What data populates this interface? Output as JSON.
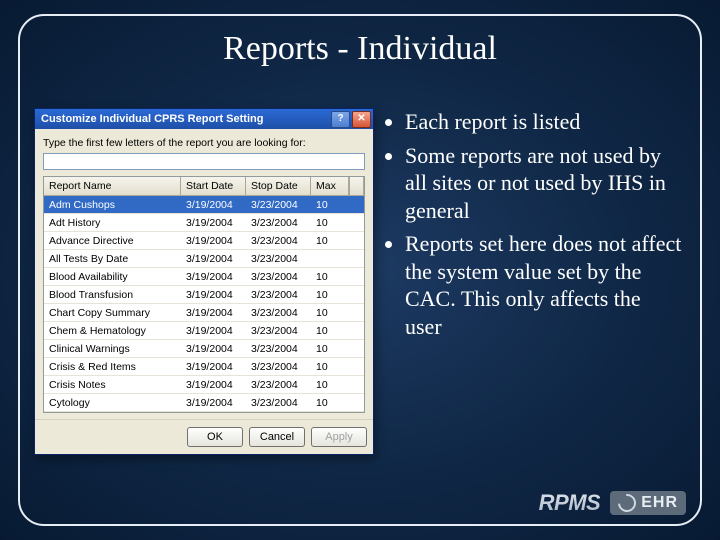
{
  "title": "Reports - Individual",
  "dialog": {
    "caption": "Customize Individual CPRS Report Setting",
    "prompt": "Type the first few letters of the report you are looking for:",
    "search_value": "",
    "help_glyph": "?",
    "close_glyph": "✕",
    "columns": {
      "name": "Report Name",
      "start": "Start Date",
      "stop": "Stop Date",
      "max": "Max"
    },
    "rows": [
      {
        "name": "Adm Cushops",
        "start": "3/19/2004",
        "stop": "3/23/2004",
        "max": "10"
      },
      {
        "name": "Adt History",
        "start": "3/19/2004",
        "stop": "3/23/2004",
        "max": "10"
      },
      {
        "name": "Advance Directive",
        "start": "3/19/2004",
        "stop": "3/23/2004",
        "max": "10"
      },
      {
        "name": "All Tests By Date",
        "start": "3/19/2004",
        "stop": "3/23/2004",
        "max": ""
      },
      {
        "name": "Blood Availability",
        "start": "3/19/2004",
        "stop": "3/23/2004",
        "max": "10"
      },
      {
        "name": "Blood Transfusion",
        "start": "3/19/2004",
        "stop": "3/23/2004",
        "max": "10"
      },
      {
        "name": "Chart Copy Summary",
        "start": "3/19/2004",
        "stop": "3/23/2004",
        "max": "10"
      },
      {
        "name": "Chem & Hematology",
        "start": "3/19/2004",
        "stop": "3/23/2004",
        "max": "10"
      },
      {
        "name": "Clinical Warnings",
        "start": "3/19/2004",
        "stop": "3/23/2004",
        "max": "10"
      },
      {
        "name": "Crisis & Red Items",
        "start": "3/19/2004",
        "stop": "3/23/2004",
        "max": "10"
      },
      {
        "name": "Crisis Notes",
        "start": "3/19/2004",
        "stop": "3/23/2004",
        "max": "10"
      },
      {
        "name": "Cytology",
        "start": "3/19/2004",
        "stop": "3/23/2004",
        "max": "10"
      }
    ],
    "selected_index": 0,
    "buttons": {
      "ok": "OK",
      "cancel": "Cancel",
      "apply": "Apply"
    }
  },
  "bullets": [
    "Each report is listed",
    "Some reports are not used by all sites or not used by IHS in general",
    "Reports set here does not affect the system value set by the CAC. This only affects the user"
  ],
  "logos": {
    "rpms": "RPMS",
    "ehr": "EHR"
  }
}
